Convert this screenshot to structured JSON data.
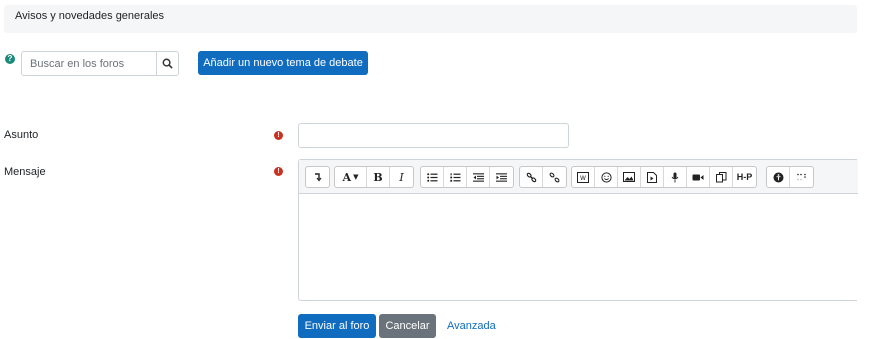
{
  "breadcrumb": {
    "text": "Avisos y novedades generales"
  },
  "search": {
    "placeholder": "Buscar en los foros"
  },
  "actions": {
    "add_topic": "Añadir un nuevo tema de debate"
  },
  "form": {
    "subject_label": "Asunto",
    "message_label": "Mensaje",
    "submit": "Enviar al foro",
    "cancel": "Cancelar",
    "advanced": "Avanzada"
  },
  "toolbar": {
    "font_style_glyph": "A",
    "bold": "B",
    "italic": "I",
    "h5p": "H-P"
  },
  "colors": {
    "primary": "#0f6cbf",
    "secondary": "#6a737b",
    "required": "#ca3120",
    "help": "#1a8a7a"
  }
}
